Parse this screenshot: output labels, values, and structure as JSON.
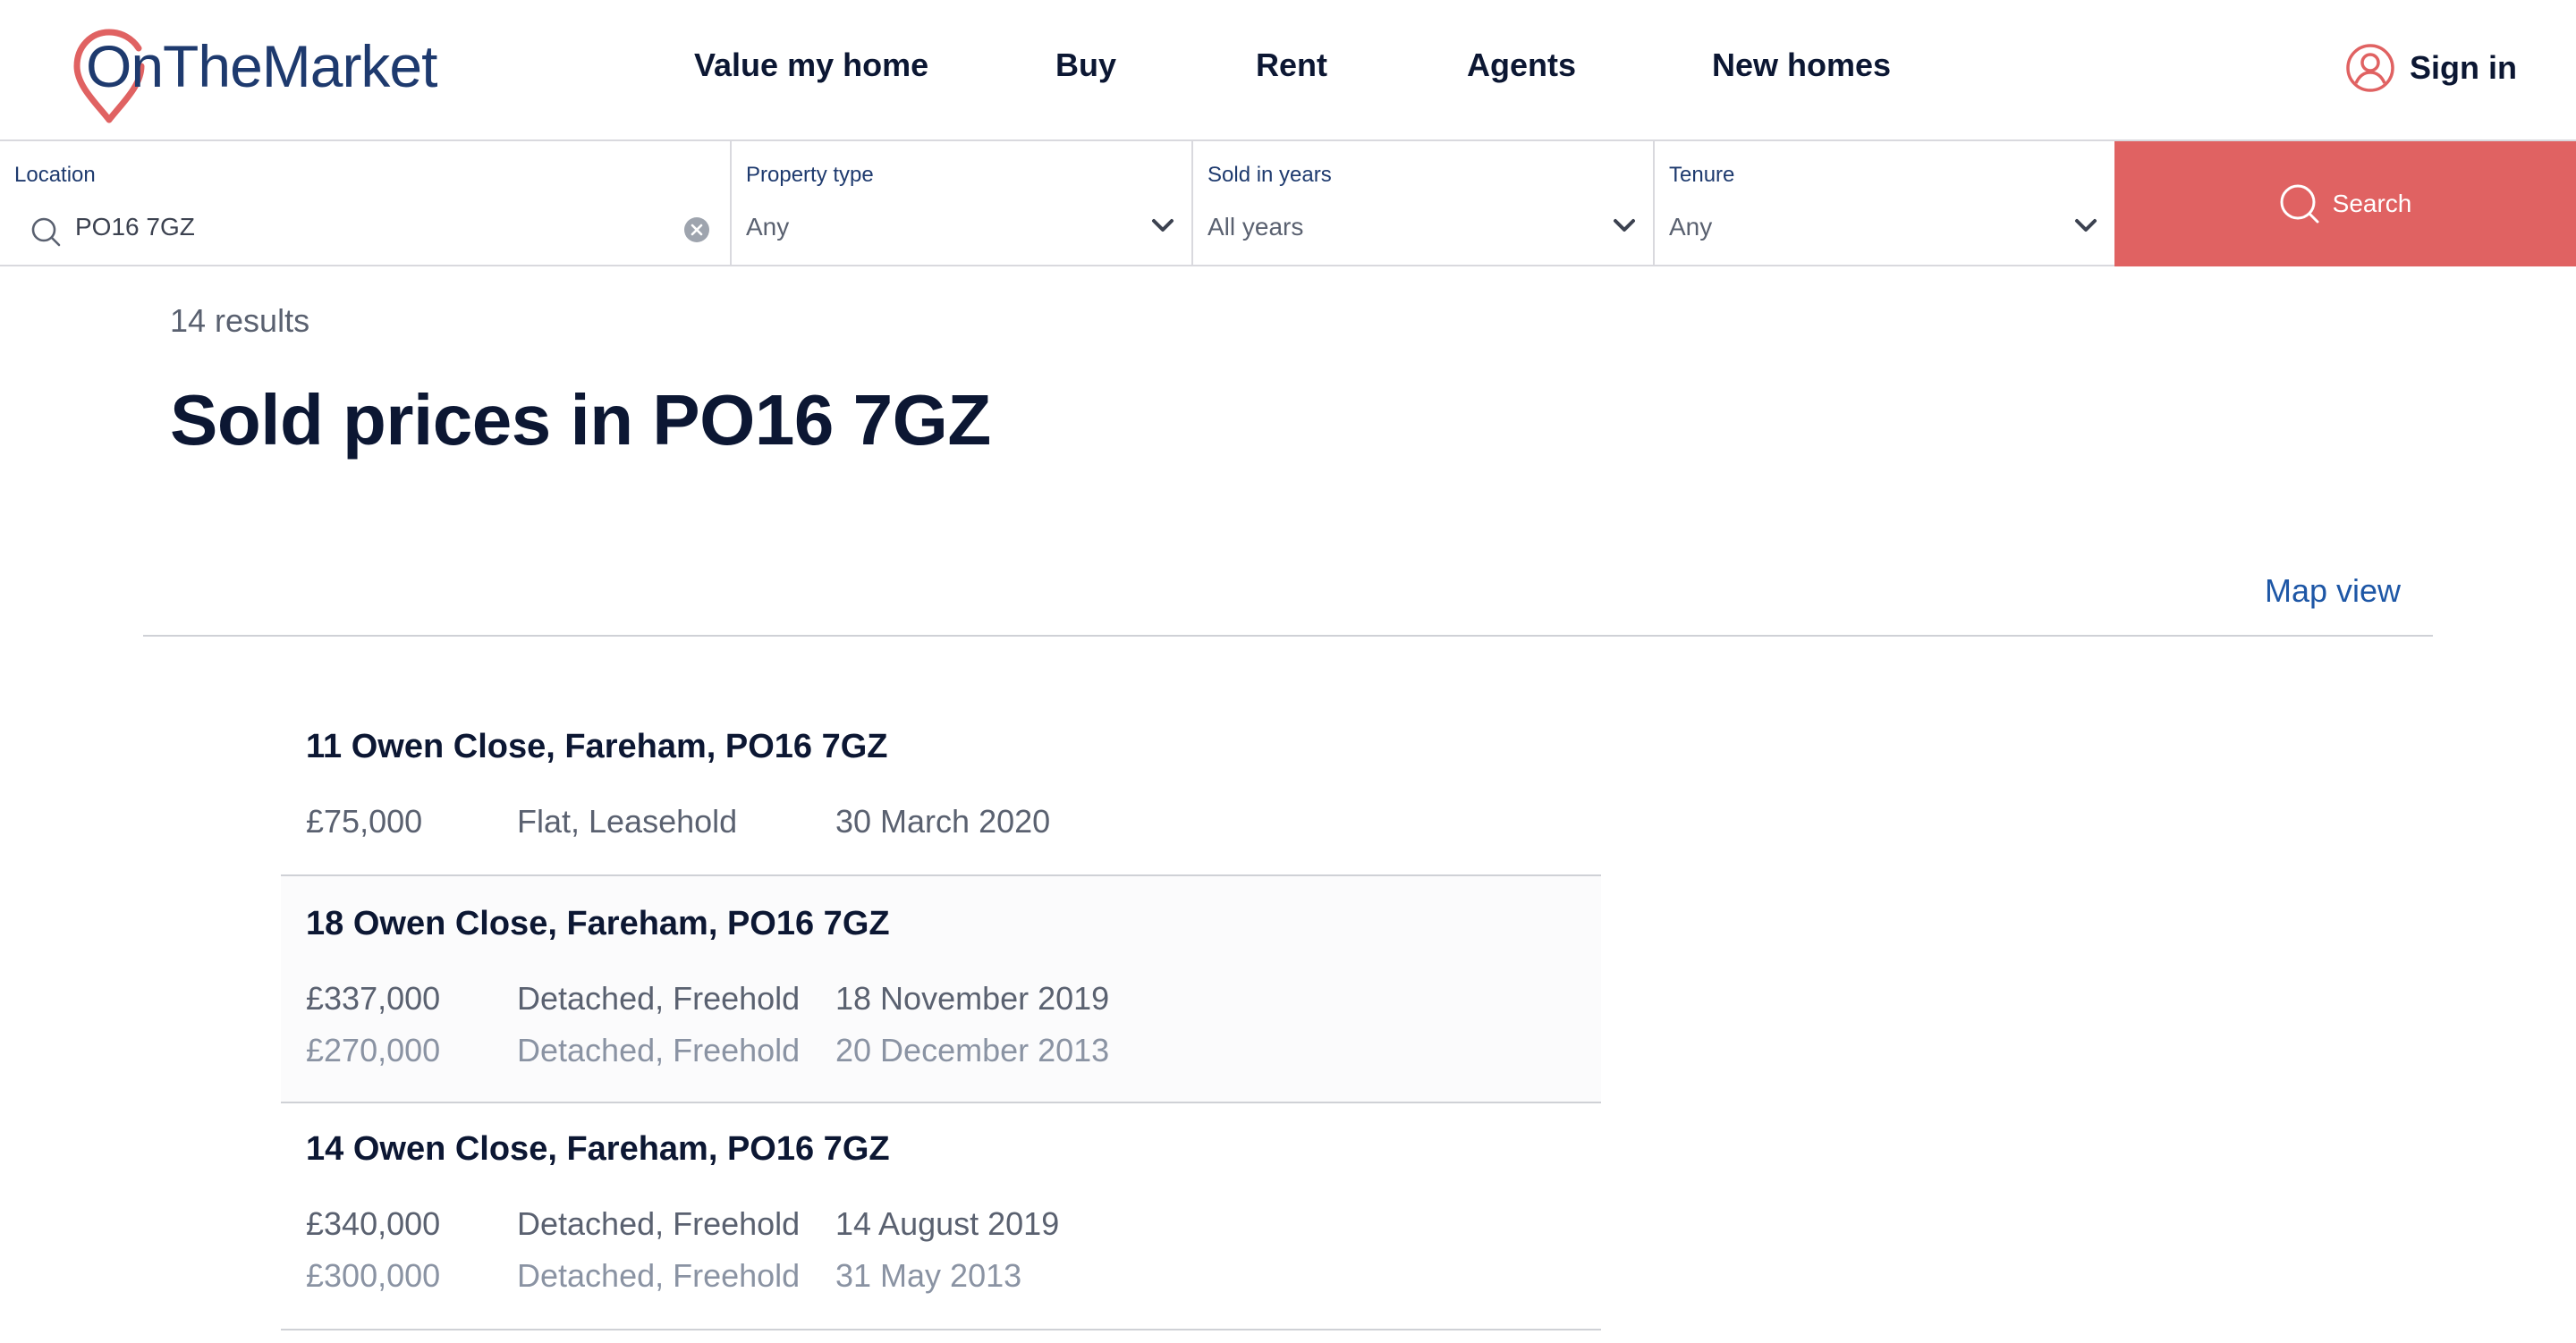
{
  "header": {
    "logo_text": "OnTheMarket",
    "nav": [
      {
        "label": "Value my home"
      },
      {
        "label": "Buy"
      },
      {
        "label": "Rent"
      },
      {
        "label": "Agents"
      },
      {
        "label": "New homes"
      }
    ],
    "sign_in_label": "Sign in"
  },
  "search": {
    "location": {
      "label": "Location",
      "value": "PO16 7GZ"
    },
    "property_type": {
      "label": "Property type",
      "value": "Any"
    },
    "sold_in_years": {
      "label": "Sold in years",
      "value": "All years"
    },
    "tenure": {
      "label": "Tenure",
      "value": "Any"
    },
    "button_label": "Search"
  },
  "results": {
    "count_text": "14 results",
    "title": "Sold prices in PO16 7GZ",
    "map_view_label": "Map view",
    "items": [
      {
        "address": "11 Owen Close, Fareham, PO16 7GZ",
        "sales": [
          {
            "price": "£75,000",
            "type": "Flat, Leasehold",
            "date": "30 March 2020"
          }
        ]
      },
      {
        "address": "18 Owen Close, Fareham, PO16 7GZ",
        "sales": [
          {
            "price": "£337,000",
            "type": "Detached, Freehold",
            "date": "18 November 2019"
          },
          {
            "price": "£270,000",
            "type": "Detached, Freehold",
            "date": "20 December 2013"
          }
        ]
      },
      {
        "address": "14 Owen Close, Fareham, PO16 7GZ",
        "sales": [
          {
            "price": "£340,000",
            "type": "Detached, Freehold",
            "date": "14 August 2019"
          },
          {
            "price": "£300,000",
            "type": "Detached, Freehold",
            "date": "31 May 2013"
          }
        ]
      }
    ]
  },
  "colors": {
    "brand_red": "#e06262",
    "brand_navy": "#1e3a6e",
    "link_blue": "#1e57a6"
  }
}
